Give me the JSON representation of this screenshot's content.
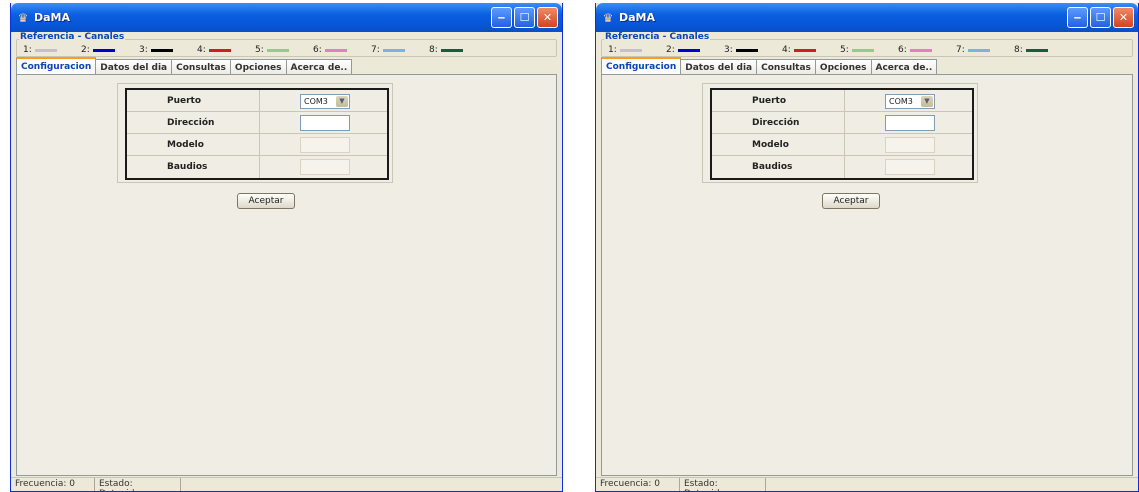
{
  "windows": [
    {
      "title": "DaMA",
      "legend_title": "Referencia - Canales",
      "channels": [
        {
          "label": "1:",
          "color": "#c8c0c8"
        },
        {
          "label": "2:",
          "color": "#0000cc"
        },
        {
          "label": "3:",
          "color": "#000000"
        },
        {
          "label": "4:",
          "color": "#cc2020"
        },
        {
          "label": "5:",
          "color": "#90cc90"
        },
        {
          "label": "6:",
          "color": "#e080c0"
        },
        {
          "label": "7:",
          "color": "#80b0e0"
        },
        {
          "label": "8:",
          "color": "#106040"
        }
      ],
      "tabs": [
        "Configuracion",
        "Datos del dia",
        "Consultas",
        "Opciones",
        "Acerca de.."
      ],
      "form": {
        "puerto_label": "Puerto",
        "puerto_value": "COM3",
        "direccion_label": "Dirección",
        "modelo_label": "Modelo",
        "baudios_label": "Baudios"
      },
      "accept_label": "Aceptar",
      "status": {
        "frecuencia": "Frecuencia: 0",
        "estado": "Estado: Detenido"
      }
    },
    {
      "title": "DaMA",
      "legend_title": "Referencia - Canales",
      "channels": [
        {
          "label": "1:",
          "color": "#c8c0c8"
        },
        {
          "label": "2:",
          "color": "#0000cc"
        },
        {
          "label": "3:",
          "color": "#000000"
        },
        {
          "label": "4:",
          "color": "#cc2020"
        },
        {
          "label": "5:",
          "color": "#90cc90"
        },
        {
          "label": "6:",
          "color": "#e080c0"
        },
        {
          "label": "7:",
          "color": "#80b0e0"
        },
        {
          "label": "8:",
          "color": "#106040"
        }
      ],
      "tabs": [
        "Configuracion",
        "Datos del dia",
        "Consultas",
        "Opciones",
        "Acerca de.."
      ],
      "form": {
        "puerto_label": "Puerto",
        "puerto_value": "COM3",
        "direccion_label": "Dirección",
        "modelo_label": "Modelo",
        "baudios_label": "Baudios"
      },
      "accept_label": "Aceptar",
      "status": {
        "frecuencia": "Frecuencia: 0",
        "estado": "Estado: Detenido"
      }
    }
  ]
}
